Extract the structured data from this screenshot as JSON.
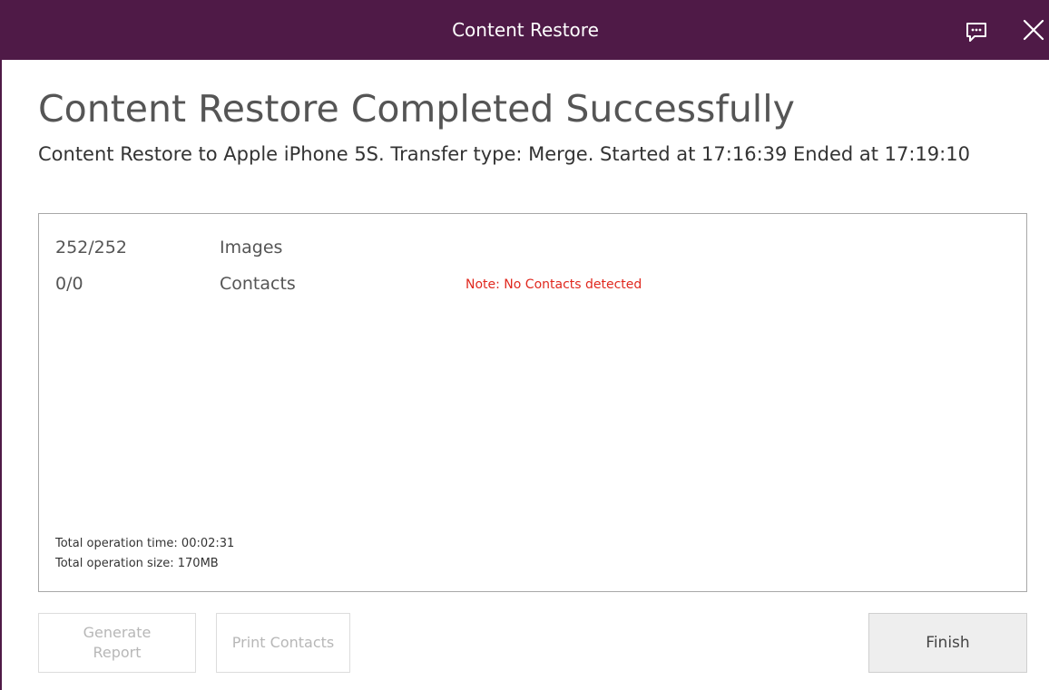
{
  "window": {
    "title": "Content Restore"
  },
  "icons": {
    "feedback": "feedback-icon",
    "close": "close-icon"
  },
  "colors": {
    "titlebar": "#4f1a47",
    "note": "#e0281e"
  },
  "main": {
    "heading": "Content Restore Completed Successfully",
    "subheading": "Content Restore to Apple iPhone 5S. Transfer type: Merge. Started at 17:16:39 Ended at 17:19:10"
  },
  "results": {
    "items": [
      {
        "count": "252/252",
        "label": "Images",
        "note": ""
      },
      {
        "count": "0/0",
        "label": "Contacts",
        "note": "Note: No Contacts detected"
      }
    ],
    "total_time": "Total operation time: 00:02:31",
    "total_size": "Total operation size: 170MB"
  },
  "buttons": {
    "generate_report": "Generate Report",
    "print_contacts": "Print Contacts",
    "finish": "Finish"
  }
}
